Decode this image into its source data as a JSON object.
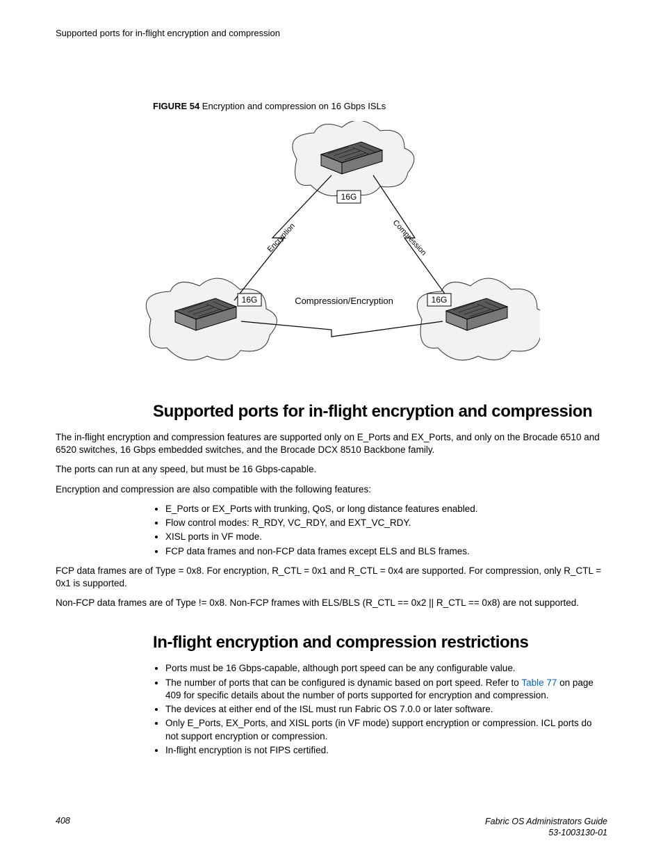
{
  "header": {
    "running_title": "Supported ports for in-flight encryption and compression"
  },
  "figure": {
    "label_bold": "FIGURE 54",
    "label_rest": " Encryption and compression on 16 Gbps ISLs",
    "labels": {
      "top": "16G",
      "left": "16G",
      "right": "16G",
      "edge_left": "Encryption",
      "edge_right": "Compression",
      "edge_bottom": "Compression/Encryption"
    }
  },
  "section1": {
    "title": "Supported ports for in-flight encryption and compression",
    "p1": "The in-flight encryption and compression features are supported only on E_Ports and EX_Ports, and only on the Brocade 6510 and 6520 switches, 16 Gbps embedded switches, and the Brocade DCX 8510 Backbone family.",
    "p2": "The ports can run at any speed, but must be 16 Gbps-capable.",
    "p3": "Encryption and compression are also compatible with the following features:",
    "bullets": [
      "E_Ports or EX_Ports with trunking, QoS, or long distance features enabled.",
      "Flow control modes: R_RDY, VC_RDY, and EXT_VC_RDY.",
      "XISL ports in VF mode.",
      "FCP data frames and non-FCP data frames except ELS and BLS frames."
    ],
    "p4": "FCP data frames are of Type = 0x8. For encryption, R_CTL = 0x1 and R_CTL = 0x4 are supported. For compression, only R_CTL = 0x1 is supported.",
    "p5": "Non-FCP data frames are of Type != 0x8. Non-FCP frames with ELS/BLS (R_CTL == 0x2 || R_CTL == 0x8) are not supported."
  },
  "section2": {
    "title": "In-flight encryption and compression restrictions",
    "b1": "Ports must be 16 Gbps-capable, although port speed can be any configurable value.",
    "b2a": "The number of ports that can be configured is dynamic based on port speed. Refer to ",
    "b2_link": "Table 77",
    "b2b": " on page 409 for specific details about the number of ports supported for encryption and compression.",
    "b3": "The devices at either end of the ISL must run Fabric OS 7.0.0 or later software.",
    "b4": "Only E_Ports, EX_Ports, and XISL ports (in VF mode) support encryption or compression. ICL ports do not support encryption or compression.",
    "b5": "In-flight encryption is not FIPS certified."
  },
  "footer": {
    "page": "408",
    "title": "Fabric OS Administrators Guide",
    "docnum": "53-1003130-01"
  }
}
